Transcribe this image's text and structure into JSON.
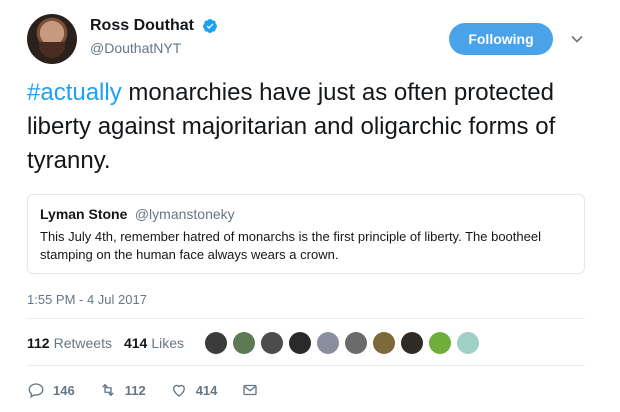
{
  "header": {
    "name": "Ross Douthat",
    "handle": "@DouthatNYT",
    "follow_label": "Following"
  },
  "tweet": {
    "hashtag": "#actually",
    "text": " monarchies have just as often protected liberty against majoritarian and oligarchic forms of tyranny."
  },
  "quote": {
    "name": "Lyman Stone",
    "handle": "@lymanstoneky",
    "text": "This July 4th, remember hatred of monarchs is the first principle of liberty. The bootheel stamping on the human face always wears a crown."
  },
  "timestamp": "1:55 PM - 4 Jul 2017",
  "stats": {
    "retweets_count": "112",
    "retweets_label": "Retweets",
    "likes_count": "414",
    "likes_label": "Likes"
  },
  "likers": [
    {
      "color": "#3b3b3b"
    },
    {
      "color": "#5e7a55"
    },
    {
      "color": "#4b4b4b"
    },
    {
      "color": "#2a2a2a"
    },
    {
      "color": "#8a8fa0"
    },
    {
      "color": "#6b6b6b"
    },
    {
      "color": "#7c6a3a"
    },
    {
      "color": "#2f2a24"
    },
    {
      "color": "#6fae3a"
    },
    {
      "color": "#9fd0c8"
    }
  ],
  "actions": {
    "reply_count": "146",
    "retweet_count": "112",
    "like_count": "414"
  },
  "colors": {
    "accent": "#1da1f2",
    "follow_button": "#4aa3e8",
    "text": "#14171a",
    "muted": "#657786"
  }
}
